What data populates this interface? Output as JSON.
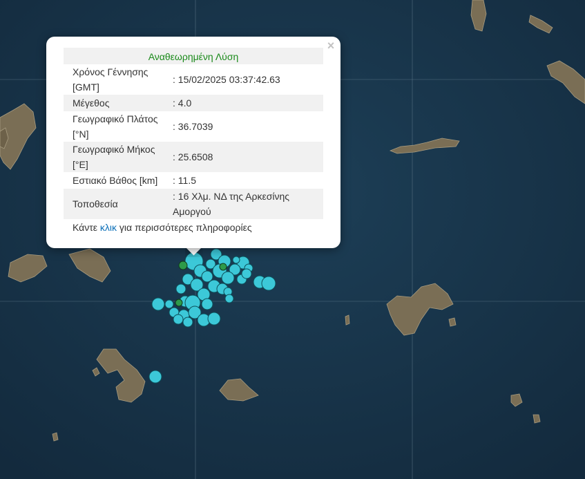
{
  "popup": {
    "header": "Αναθεωρημένη Λύση",
    "close_icon": "close-icon",
    "rows": [
      {
        "label": "Χρόνος Γέννησης [GMT]",
        "value": ": 15/02/2025 03:37:42.63"
      },
      {
        "label": "Μέγεθος",
        "value": ": 4.0"
      },
      {
        "label": "Γεωγραφικό Πλάτος [°N]",
        "value": ": 36.7039"
      },
      {
        "label": "Γεωγραφικό Μήκος [°E]",
        "value": ": 25.6508"
      },
      {
        "label": "Εστιακό Βάθος [km]",
        "value": ": 11.5"
      },
      {
        "label": "Τοποθεσία",
        "value": ": 16 Χλμ. ΝΔ της Αρκεσίνης Αμοργού"
      }
    ],
    "more_prefix": "Κάντε ",
    "more_link": "κλικ",
    "more_suffix": " για περισσότερες πληροφορίες"
  },
  "map": {
    "colors": {
      "sea": "#17344a",
      "land": "#7a6e55",
      "event_marker": "#3cc8d8",
      "recent_marker": "#2e9a4a",
      "graticule": "#6f8797"
    }
  }
}
